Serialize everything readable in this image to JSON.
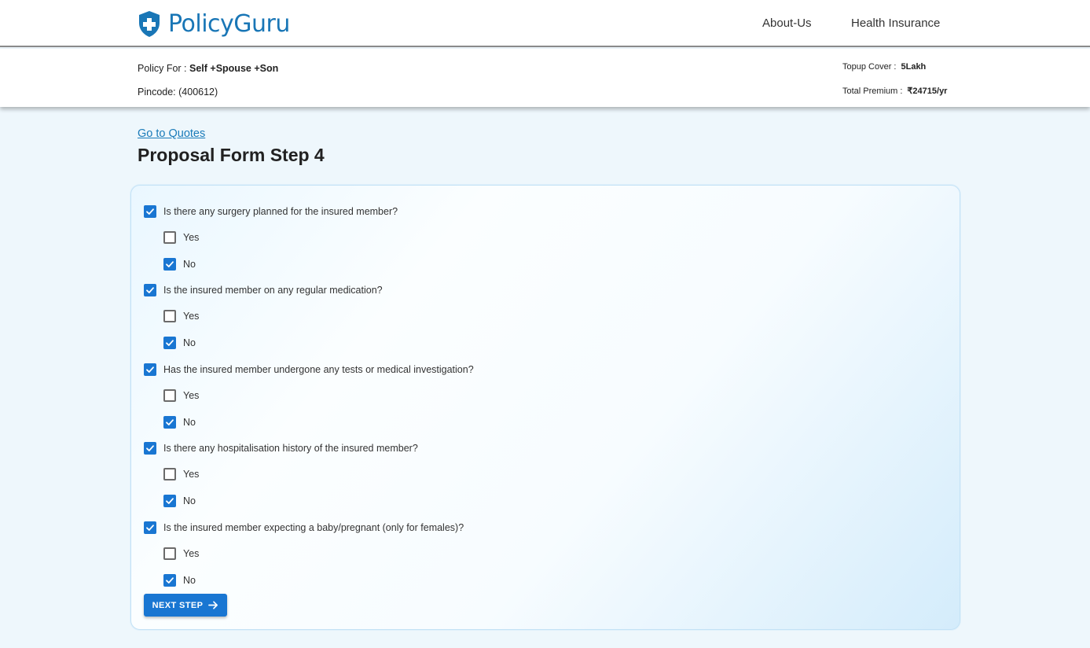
{
  "brand": {
    "name": "PolicyGuru",
    "color": "#1976b6",
    "logo_icon": "shield-plus-icon"
  },
  "nav": {
    "about": "About-Us",
    "health": "Health Insurance"
  },
  "summary": {
    "policy_label": "Policy For : ",
    "policy_value": "Self +Spouse +Son",
    "pincode_label": "Pincode: ",
    "pincode_value": "(400612)",
    "topup_label": "Topup Cover :",
    "topup_value": "5Lakh",
    "premium_label": "Total Premium :",
    "premium_value": "₹24715/yr"
  },
  "main": {
    "goto_quotes": "Go to Quotes",
    "title": "Proposal Form Step 4",
    "next_button": "NEXT STEP",
    "next_icon": "arrow-right-icon",
    "accent": "#1976d2"
  },
  "questions": [
    {
      "text": "Is there any surgery planned for the insured member?",
      "checked": true,
      "options": [
        {
          "label": "Yes",
          "checked": false
        },
        {
          "label": "No",
          "checked": true
        }
      ]
    },
    {
      "text": "Is the insured member on any regular medication?",
      "checked": true,
      "options": [
        {
          "label": "Yes",
          "checked": false
        },
        {
          "label": "No",
          "checked": true
        }
      ]
    },
    {
      "text": "Has the insured member undergone any tests or medical investigation?",
      "checked": true,
      "options": [
        {
          "label": "Yes",
          "checked": false
        },
        {
          "label": "No",
          "checked": true
        }
      ]
    },
    {
      "text": "Is there any hospitalisation history of the insured member?",
      "checked": true,
      "options": [
        {
          "label": "Yes",
          "checked": false
        },
        {
          "label": "No",
          "checked": true
        }
      ]
    },
    {
      "text": "Is the insured member expecting a baby/pregnant (only for females)?",
      "checked": true,
      "options": [
        {
          "label": "Yes",
          "checked": false
        },
        {
          "label": "No",
          "checked": true
        }
      ]
    }
  ]
}
